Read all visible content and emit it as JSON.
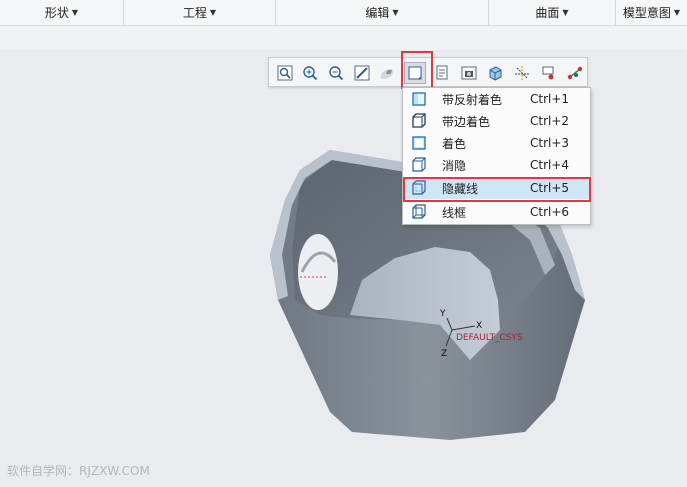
{
  "ribbon": {
    "groups": [
      {
        "label": "形状"
      },
      {
        "label": "工程"
      },
      {
        "label": "编辑"
      },
      {
        "label": "曲面"
      },
      {
        "label": "模型意图"
      }
    ]
  },
  "graphics_toolbar": {
    "buttons": [
      {
        "name": "refit-icon"
      },
      {
        "name": "zoom-in-icon"
      },
      {
        "name": "zoom-out-icon"
      },
      {
        "name": "repaint-icon"
      },
      {
        "name": "perspective-icon"
      },
      {
        "name": "display-style-icon"
      },
      {
        "name": "saved-orientations-icon"
      },
      {
        "name": "view-manager-icon"
      },
      {
        "name": "named-view-icon"
      },
      {
        "name": "datum-display-icon"
      },
      {
        "name": "spin-center-icon"
      },
      {
        "name": "annotation-display-icon"
      }
    ]
  },
  "display_style_menu": {
    "items": [
      {
        "label": "带反射着色",
        "shortcut": "Ctrl+1",
        "icon": "shading-reflections-icon"
      },
      {
        "label": "带边着色",
        "shortcut": "Ctrl+2",
        "icon": "shading-edges-icon"
      },
      {
        "label": "着色",
        "shortcut": "Ctrl+3",
        "icon": "shading-icon"
      },
      {
        "label": "消隐",
        "shortcut": "Ctrl+4",
        "icon": "no-hidden-icon"
      },
      {
        "label": "隐藏线",
        "shortcut": "Ctrl+5",
        "icon": "hidden-line-icon"
      },
      {
        "label": "线框",
        "shortcut": "Ctrl+6",
        "icon": "wireframe-icon"
      }
    ],
    "selected_index": 4
  },
  "model": {
    "csys_label": "DEFAULT_CSYS",
    "axes": [
      "Y",
      "X",
      "Z"
    ],
    "shell_color": "#7f8792"
  },
  "watermark": "软件自学网：RJZXW.COM"
}
